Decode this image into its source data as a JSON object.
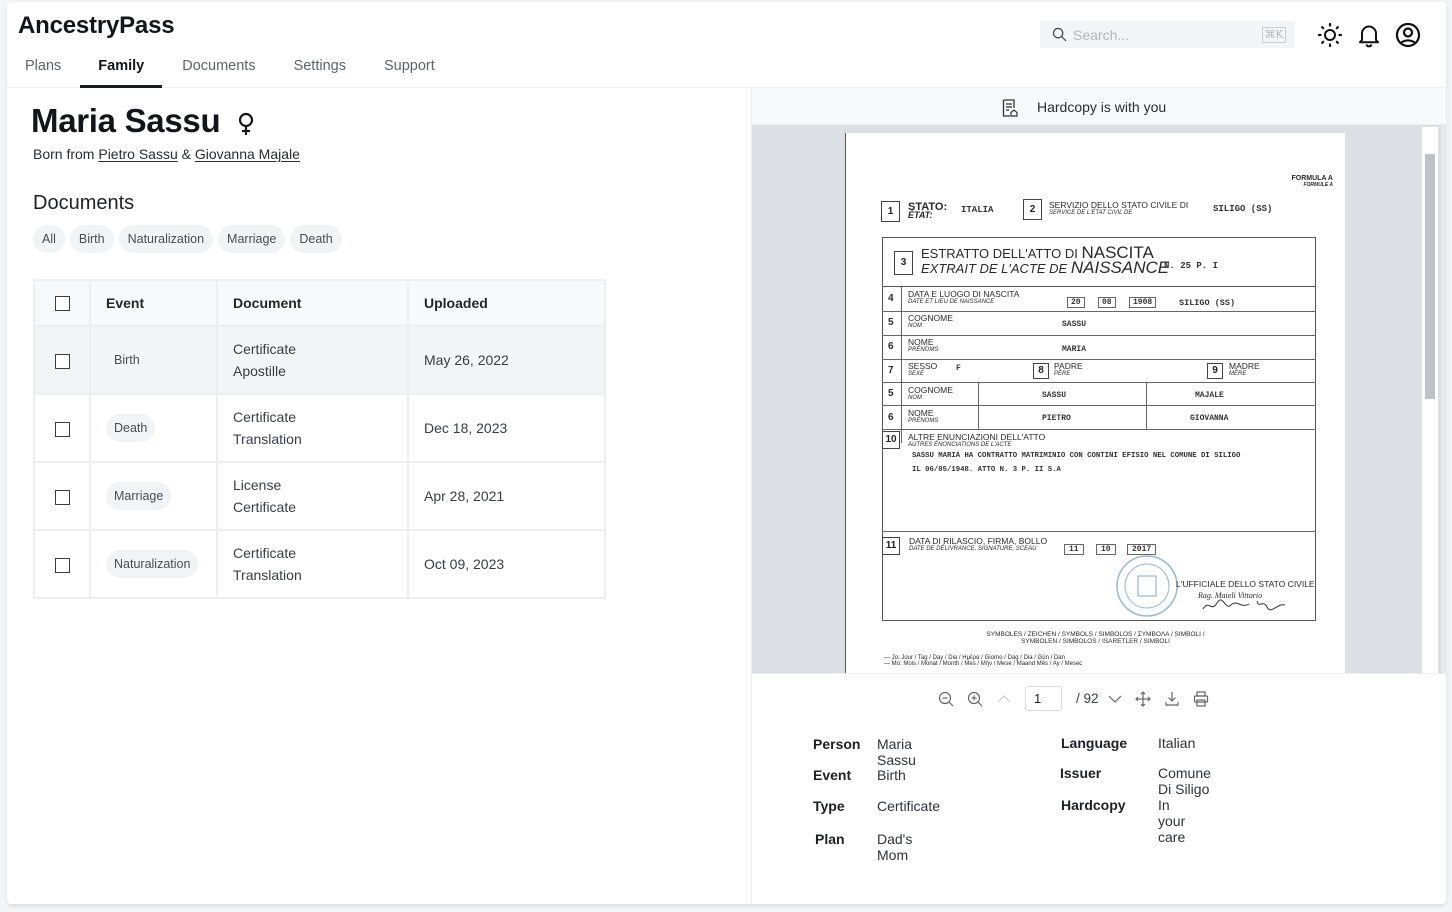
{
  "app": {
    "brand": "AncestryPass",
    "nav": [
      {
        "label": "Plans",
        "active": false
      },
      {
        "label": "Family",
        "active": true
      },
      {
        "label": "Documents",
        "active": false
      },
      {
        "label": "Settings",
        "active": false
      },
      {
        "label": "Support",
        "active": false
      }
    ],
    "search": {
      "placeholder": "Search...",
      "value": "",
      "shortcut": "⌘K"
    },
    "icons": [
      "sun-icon",
      "bell-icon",
      "user-circle-icon"
    ]
  },
  "person": {
    "name": "Maria Sassu",
    "gender_symbol": "♀",
    "born_prefix": "Born from",
    "father": "Pietro Sassu",
    "connector": "&",
    "mother": "Giovanna Majale"
  },
  "documents": {
    "title": "Documents",
    "filters": [
      "All",
      "Birth",
      "Naturalization",
      "Marriage",
      "Death"
    ],
    "columns": [
      "Event",
      "Document",
      "Uploaded"
    ],
    "rows": [
      {
        "event": "Birth",
        "doc_line1": "Certificate",
        "doc_line2": "Apostille",
        "uploaded": "May 26, 2022",
        "selected": true,
        "checked": false
      },
      {
        "event": "Death",
        "doc_line1": "Certificate",
        "doc_line2": "Translation",
        "uploaded": "Dec 18, 2023",
        "selected": false,
        "checked": false
      },
      {
        "event": "Marriage",
        "doc_line1": "License",
        "doc_line2": "Certificate",
        "uploaded": "Apr 28, 2021",
        "selected": false,
        "checked": false
      },
      {
        "event": "Naturalization",
        "doc_line1": "Certificate",
        "doc_line2": "Translation",
        "uploaded": "Oct 09, 2023",
        "selected": false,
        "checked": false
      }
    ]
  },
  "viewer": {
    "hardcopy_text": "Hardcopy is with you",
    "current_page": "1",
    "total_pages": "/ 92",
    "toolbar_icons": [
      "zoom-out-icon",
      "zoom-in-icon",
      "chevron-up-icon",
      "chevron-down-icon",
      "move-icon",
      "download-icon",
      "print-icon"
    ],
    "scan": {
      "formula": "FORMULA A",
      "formule": "FORMULE A",
      "f1_label": "STATO:",
      "f1_label_fr": "ÉTAT:",
      "f1_value": "ITALIA",
      "f2_label": "SERVIZIO DELLO STATO CIVILE DI",
      "f2_label_fr": "SERVICE DE L'ÉTAT CIVIL DE",
      "f2_value": "SILIGO (SS)",
      "f3_title_a": "ESTRATTO DELL'ATTO DI",
      "f3_title_b": "NASCITA",
      "f3_sub_a": "EXTRAIT DE L'ACTE DE",
      "f3_sub_b": "NAISSANCE",
      "f3_number": "N. 25  P. I",
      "f4_label": "DATA E LUOGO DI NASCITA",
      "f4_label_fr": "DATE ET LIEU DE NAISSANCE",
      "f4_day": "20",
      "f4_month": "08",
      "f4_year": "1908",
      "f4_place": "SILIGO (SS)",
      "f5_label": "COGNOME",
      "f5_label_fr": "NOM",
      "f5_value": "SASSU",
      "f6_label": "NOME",
      "f6_label_fr": "PRÉNOMS",
      "f6_value": "MARIA",
      "f7_label": "SESSO",
      "f7_label_fr": "SEXE",
      "f7_value": "F",
      "f8_label": "PADRE",
      "f8_label_fr": "PÈRE",
      "f9_label": "MADRE",
      "f9_label_fr": "MÈRE",
      "father_surname": "SASSU",
      "mother_surname": "MAJALE",
      "father_name": "PIETRO",
      "mother_name": "GIOVANNA",
      "f10_label": "ALTRE ENUNCIAZIONI DELL'ATTO",
      "f10_label_fr": "AUTRES ÉNONCIATIONS DE L'ACTE",
      "f10_line1": "SASSU MARIA HA CONTRATTO MATRIMINIO CON CONTINI EFISIO NEL COMUNE DI SILIGO",
      "f10_line2": "IL 06/05/1948. ATTO N. 3 P. II S.A",
      "f11_label": "DATA DI RILASCIO, FIRMA, BOLLO",
      "f11_label_fr": "DATE DE DÉLIVRANCE, SIGNATURE, SCEAU",
      "f11_day": "11",
      "f11_month": "10",
      "f11_year": "2017",
      "officer": "L'UFFICIALE DELLO STATO CIVILE",
      "officer_name": "Rag. Maieli Vittorio",
      "symbols_line1": "SYMBOLES / ZEICHEN / SYMBOLS / SIMBOLOS / ΣΥΜΒΟΛΑ / SIMBOLI /",
      "symbols_line2": "SYMBOLEN / SIMBOLOS / ISARETLER / SIMBOLI",
      "legend_jo": "— Jo: Jour / Tag / Day / Dia / Ημέρα / Giorno / Dag / Dia / Gün / Dan",
      "legend_mo": "— Mo: Mois / Monat / Month / Mes / Μήν / Mese / Maand Mês / Ay / Mesec"
    }
  },
  "details": {
    "left": [
      {
        "label": "Person",
        "value": "Maria Sassu"
      },
      {
        "label": "Event",
        "value": "Birth"
      },
      {
        "label": "Type",
        "value": "Certificate"
      },
      {
        "label": "Plan",
        "value": "Dad's Mom"
      }
    ],
    "right": [
      {
        "label": "Language",
        "value": "Italian"
      },
      {
        "label": "Issuer",
        "value": "Comune Di Siligo"
      },
      {
        "label": "Hardcopy",
        "value": "In your care"
      }
    ]
  }
}
